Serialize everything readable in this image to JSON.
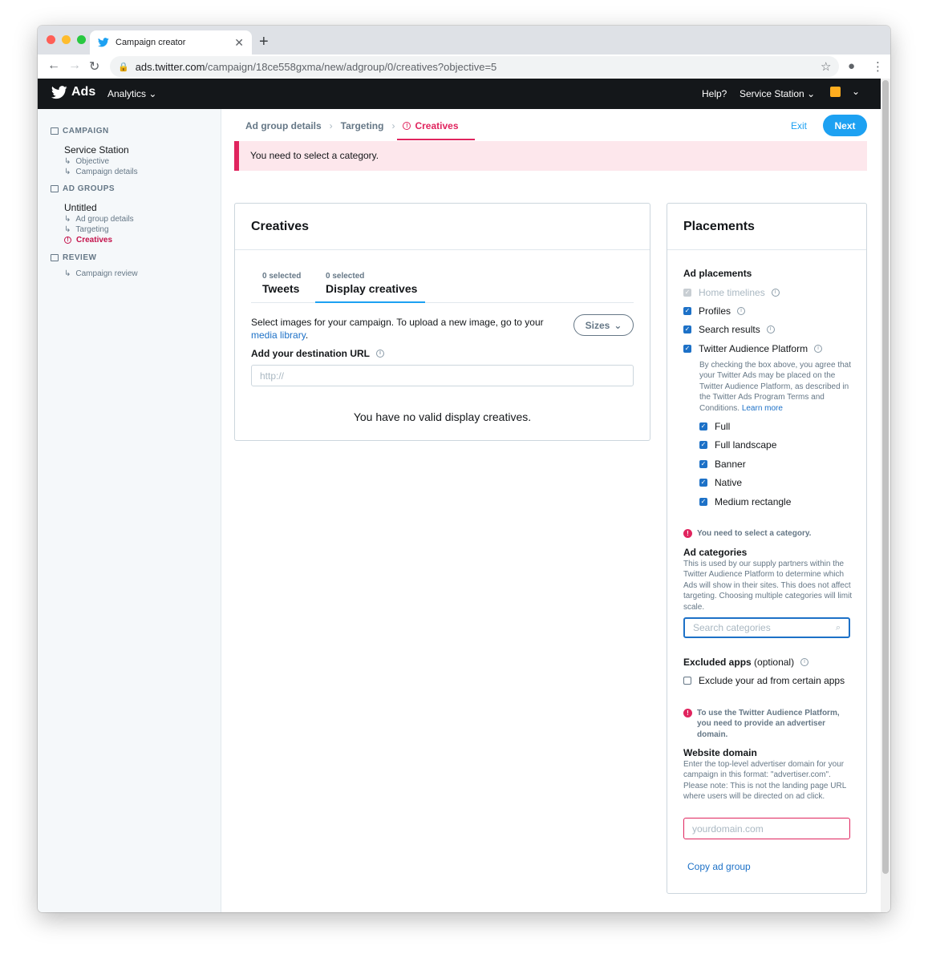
{
  "browser": {
    "tab_title": "Campaign creator",
    "url_host": "ads.twitter.com",
    "url_path": "/campaign/18ce558gxma/new/adgroup/0/creatives?objective=5"
  },
  "header": {
    "brand": "Ads",
    "analytics": "Analytics",
    "help": "Help?",
    "account": "Service Station"
  },
  "sidebar": {
    "campaign_title": "CAMPAIGN",
    "campaign_name": "Service Station",
    "campaign_items": [
      "Objective",
      "Campaign details"
    ],
    "adgroups_title": "AD GROUPS",
    "adgroup_name": "Untitled",
    "adgroup_items": [
      "Ad group details",
      "Targeting",
      "Creatives"
    ],
    "review_title": "REVIEW",
    "review_items": [
      "Campaign review"
    ]
  },
  "breadcrumbs": [
    "Ad group details",
    "Targeting",
    "Creatives"
  ],
  "actions": {
    "exit": "Exit",
    "next": "Next"
  },
  "alert": "You need to select a category.",
  "creatives": {
    "title": "Creatives",
    "tabs": [
      {
        "count": "0 selected",
        "label": "Tweets"
      },
      {
        "count": "0 selected",
        "label": "Display creatives"
      }
    ],
    "instructions_pre": "Select images for your campaign. To upload a new image, go to your",
    "media_link": "media library",
    "instructions_post": ".",
    "sizes_button": "Sizes",
    "url_label": "Add your destination URL",
    "url_placeholder": "http://",
    "empty": "You have no valid display creatives."
  },
  "placements": {
    "title": "Placements",
    "ad_placements_label": "Ad placements",
    "options": [
      {
        "label": "Home timelines",
        "state": "disabled"
      },
      {
        "label": "Profiles",
        "state": "checked"
      },
      {
        "label": "Search results",
        "state": "checked"
      },
      {
        "label": "Twitter Audience Platform",
        "state": "checked"
      }
    ],
    "tap_note": "By checking the box above, you agree that your Twitter Ads may be placed on the Twitter Audience Platform, as described in the Twitter Ads Program Terms and Conditions.",
    "learn_more": "Learn more",
    "tap_options": [
      "Full",
      "Full landscape",
      "Banner",
      "Native",
      "Medium rectangle"
    ],
    "category_error": "You need to select a category.",
    "categories_label": "Ad categories",
    "categories_desc": "This is used by our supply partners within the Twitter Audience Platform to determine which Ads will show in their sites. This does not affect targeting. Choosing multiple categories will limit scale.",
    "categories_placeholder": "Search categories",
    "excluded_label": "Excluded apps",
    "excluded_optional": "(optional)",
    "excluded_option": "Exclude your ad from certain apps",
    "domain_error": "To use the Twitter Audience Platform, you need to provide an advertiser domain.",
    "domain_label": "Website domain",
    "domain_desc": "Enter the top-level advertiser domain for your campaign in this format: \"advertiser.com\". Please note: This is not the landing page URL where users will be directed on ad click.",
    "domain_placeholder": "yourdomain.com",
    "copy_link": "Copy ad group"
  },
  "colors": {
    "brand_blue": "#1da1f2",
    "error": "#e0245e",
    "header": "#14171a"
  }
}
